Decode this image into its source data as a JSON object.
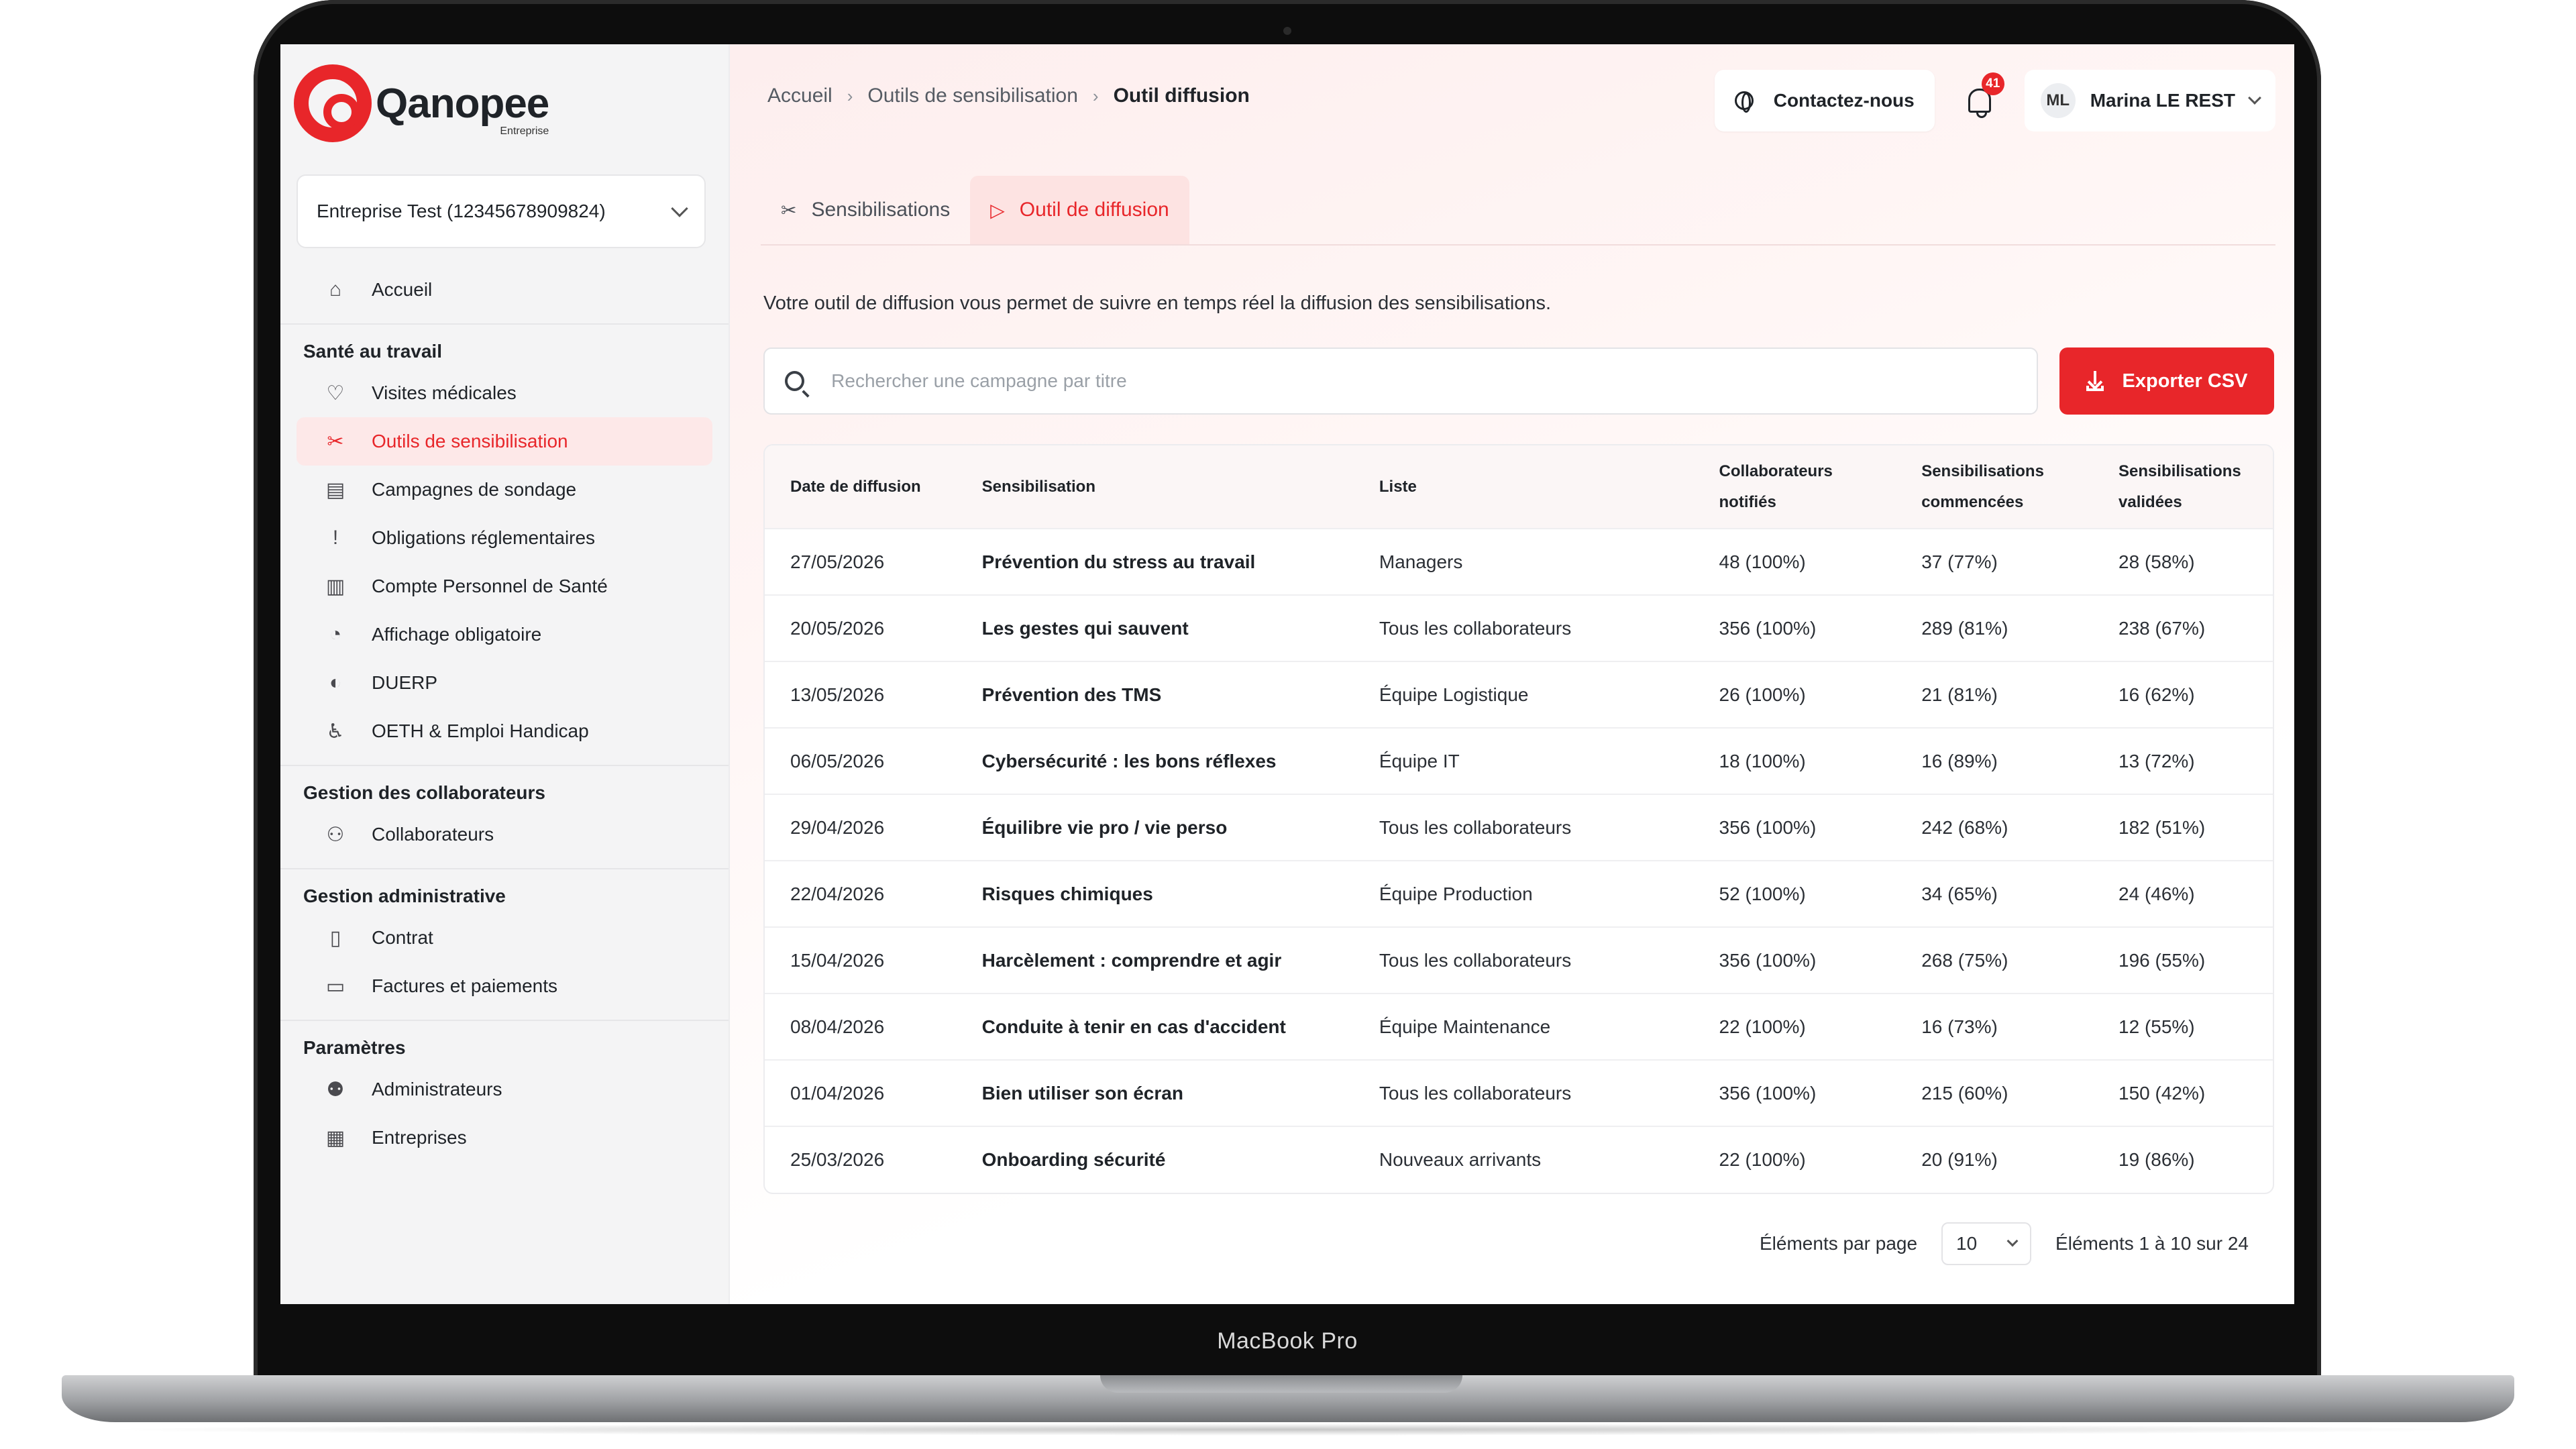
{
  "device": {
    "label": "MacBook Pro"
  },
  "brand": {
    "name": "Qanopee",
    "sub": "Entreprise",
    "accent": "#e8262a"
  },
  "company_select": {
    "value": "Entreprise Test (12345678909824)"
  },
  "sidebar": {
    "home": {
      "label": "Accueil",
      "icon": "home-icon"
    },
    "sections": [
      {
        "title": "Santé au travail",
        "items": [
          {
            "label": "Visites médicales",
            "icon": "stethoscope-icon"
          },
          {
            "label": "Outils de sensibilisation",
            "icon": "tools-icon",
            "active": true
          },
          {
            "label": "Campagnes de sondage",
            "icon": "survey-icon"
          },
          {
            "label": "Obligations réglementaires",
            "icon": "alert-icon"
          },
          {
            "label": "Compte Personnel de Santé",
            "icon": "bar-chart-icon"
          },
          {
            "label": "Affichage obligatoire",
            "icon": "display-icon"
          },
          {
            "label": "DUERP",
            "icon": "document-icon"
          },
          {
            "label": "OETH & Emploi Handicap",
            "icon": "accessibility-icon"
          }
        ]
      },
      {
        "title": "Gestion des collaborateurs",
        "items": [
          {
            "label": "Collaborateurs",
            "icon": "users-icon"
          }
        ]
      },
      {
        "title": "Gestion administrative",
        "items": [
          {
            "label": "Contrat",
            "icon": "contract-icon"
          },
          {
            "label": "Factures et paiements",
            "icon": "card-icon"
          }
        ]
      },
      {
        "title": "Paramètres",
        "items": [
          {
            "label": "Administrateurs",
            "icon": "admin-icon"
          },
          {
            "label": "Entreprises",
            "icon": "building-icon"
          }
        ]
      }
    ]
  },
  "breadcrumb": [
    "Accueil",
    "Outils de sensibilisation",
    "Outil diffusion"
  ],
  "header": {
    "contact_label": "Contactez-nous",
    "notifications": "41",
    "user_initials": "ML",
    "user_name": "Marina LE REST"
  },
  "tabs": [
    {
      "label": "Sensibilisations",
      "icon": "tools-icon",
      "active": false
    },
    {
      "label": "Outil de diffusion",
      "icon": "play-icon",
      "active": true
    }
  ],
  "intro": "Votre outil de diffusion vous permet de suivre en temps réel la diffusion des sensibilisations.",
  "search": {
    "placeholder": "Rechercher une campagne par titre"
  },
  "export_label": "Exporter CSV",
  "table": {
    "headers": [
      [
        "Date de diffusion"
      ],
      [
        "Sensibilisation"
      ],
      [
        "Liste"
      ],
      [
        "Collaborateurs",
        "notifiés"
      ],
      [
        "Sensibilisations",
        "commencées"
      ],
      [
        "Sensibilisations",
        "validées"
      ]
    ],
    "rows": [
      [
        "27/05/2026",
        "Prévention du stress au travail",
        "Managers",
        "48 (100%)",
        "37 (77%)",
        "28 (58%)"
      ],
      [
        "20/05/2026",
        "Les gestes qui sauvent",
        "Tous les collaborateurs",
        "356 (100%)",
        "289 (81%)",
        "238 (67%)"
      ],
      [
        "13/05/2026",
        "Prévention des TMS",
        "Équipe Logistique",
        "26 (100%)",
        "21 (81%)",
        "16 (62%)"
      ],
      [
        "06/05/2026",
        "Cybersécurité : les bons réflexes",
        "Équipe IT",
        "18 (100%)",
        "16 (89%)",
        "13 (72%)"
      ],
      [
        "29/04/2026",
        "Équilibre vie pro / vie perso",
        "Tous les collaborateurs",
        "356 (100%)",
        "242 (68%)",
        "182 (51%)"
      ],
      [
        "22/04/2026",
        "Risques chimiques",
        "Équipe Production",
        "52 (100%)",
        "34 (65%)",
        "24 (46%)"
      ],
      [
        "15/04/2026",
        "Harcèlement : comprendre et agir",
        "Tous les collaborateurs",
        "356 (100%)",
        "268 (75%)",
        "196 (55%)"
      ],
      [
        "08/04/2026",
        "Conduite à tenir en cas d'accident",
        "Équipe Maintenance",
        "22 (100%)",
        "16 (73%)",
        "12 (55%)"
      ],
      [
        "01/04/2026",
        "Bien utiliser son écran",
        "Tous les collaborateurs",
        "356 (100%)",
        "215 (60%)",
        "150 (42%)"
      ],
      [
        "25/03/2026",
        "Onboarding sécurité",
        "Nouveaux arrivants",
        "22 (100%)",
        "20 (91%)",
        "19 (86%)"
      ]
    ]
  },
  "pagination": {
    "per_page_label": "Éléments par page",
    "per_page_value": "10",
    "range_label": "Éléments 1 à 10 sur 24"
  }
}
